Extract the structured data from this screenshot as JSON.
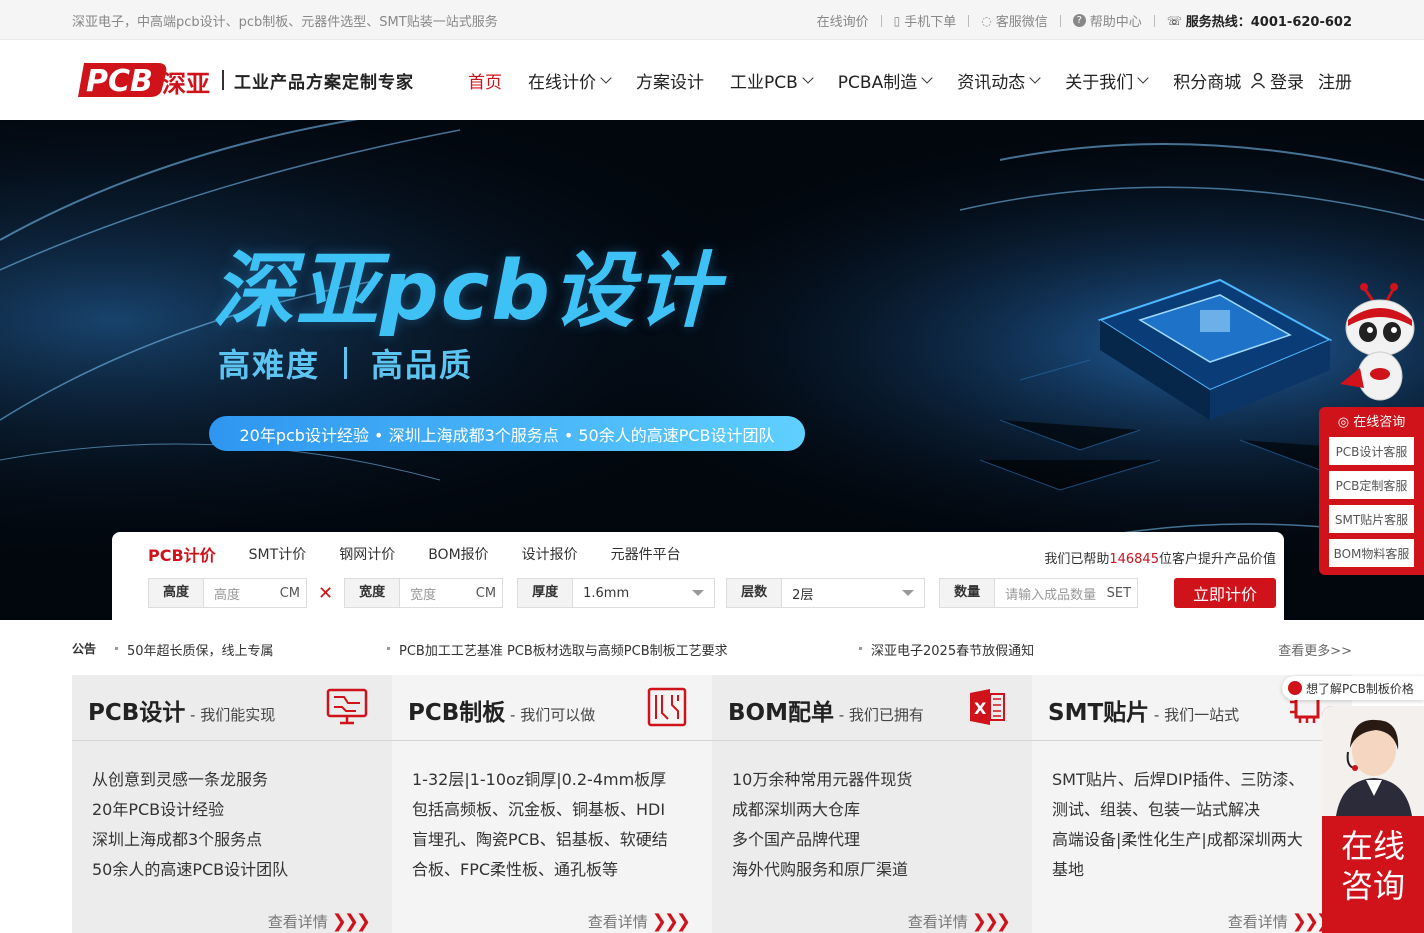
{
  "topbar": {
    "slogan": "深亚电子，中高端pcb设计、pcb制板、元器件选型、SMT贴装一站式服务",
    "links": [
      "在线询价",
      "手机下单",
      "客服微信",
      "帮助中心"
    ],
    "hotline": "服务热线：4001-620-602"
  },
  "header": {
    "logo_text": "PCB",
    "logo_cn": "深亚",
    "tagline": "工业产品方案定制专家",
    "nav": [
      {
        "label": "首页",
        "dropdown": false
      },
      {
        "label": "在线计价",
        "dropdown": true
      },
      {
        "label": "方案设计",
        "dropdown": false
      },
      {
        "label": "工业PCB",
        "dropdown": true
      },
      {
        "label": "PCBA制造",
        "dropdown": true
      },
      {
        "label": "资讯动态",
        "dropdown": true
      },
      {
        "label": "关于我们",
        "dropdown": true
      },
      {
        "label": "积分商城",
        "dropdown": false
      }
    ],
    "login": "登录",
    "register": "注册"
  },
  "banner": {
    "title": "深亚pcb设计",
    "sub_left": "高难度",
    "sub_right": "高品质",
    "pill": "20年pcb设计经验 • 深圳上海成都3个服务点 • 50余人的高速PCB设计团队"
  },
  "quote": {
    "tabs": [
      "PCB计价",
      "SMT计价",
      "钢网计价",
      "BOM报价",
      "设计报价",
      "元器件平台"
    ],
    "stat_prefix": "我们已帮助",
    "stat_num": "146845",
    "stat_suffix": "位客户提升产品价值",
    "height_label": "高度",
    "height_ph": "高度",
    "unit": "CM",
    "width_label": "宽度",
    "width_ph": "宽度",
    "thickness_label": "厚度",
    "thickness_val": "1.6mm",
    "layers_label": "层数",
    "layers_val": "2层",
    "qty_label": "数量",
    "qty_ph": "请输入成品数量",
    "qty_unit": "SET",
    "submit": "立即计价"
  },
  "notice": {
    "label": "公告",
    "items": [
      "50年超长质保，线上专属",
      "PCB加工工艺基准 PCB板材选取与高频PCB制板工艺要求",
      "深亚电子2025春节放假通知"
    ],
    "more": "查看更多>>"
  },
  "cards": [
    {
      "title": "PCB设计",
      "sub": " - 我们能实现",
      "lines": [
        "从创意到灵感一条龙服务",
        "20年PCB设计经验",
        "深圳上海成都3个服务点",
        "50余人的高速PCB设计团队"
      ],
      "more": "查看详情"
    },
    {
      "title": "PCB制板",
      "sub": " - 我们可以做",
      "lines": [
        "1-32层|1-10oz铜厚|0.2-4mm板厚",
        "包括高频板、沉金板、铜基板、HDI",
        "盲埋孔、陶瓷PCB、铝基板、软硬结",
        "合板、FPC柔性板、通孔板等"
      ],
      "more": "查看详情"
    },
    {
      "title": "BOM配单",
      "sub": " - 我们已拥有",
      "lines": [
        "10万余种常用元器件现货",
        "成都深圳两大仓库",
        "多个国产品牌代理",
        "海外代购服务和原厂渠道"
      ],
      "more": "查看详情"
    },
    {
      "title": "SMT贴片",
      "sub": " - 我们一站式",
      "lines": [
        "SMT贴片、后焊DIP插件、三防漆、",
        "测试、组装、包装一站式解决",
        "高端设备|柔性化生产|成都深圳两大",
        "基地"
      ],
      "more": "查看详情"
    }
  ],
  "side": {
    "title": "在线咨询",
    "items": [
      "PCB设计客服",
      "PCB定制客服",
      "SMT贴片客服",
      "BOM物料客服"
    ],
    "tip": "想了解PCB制板价格",
    "agent": "在线咨询"
  }
}
